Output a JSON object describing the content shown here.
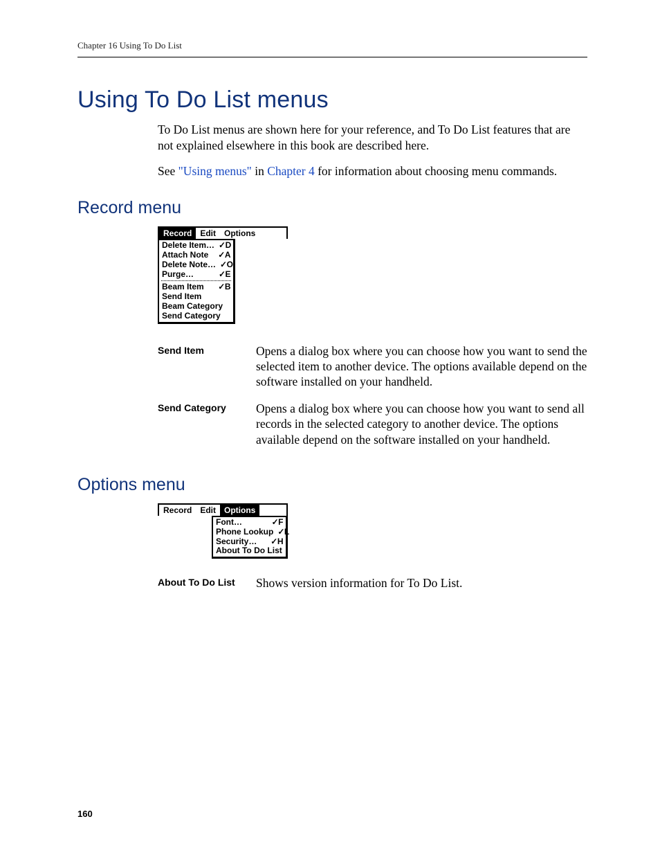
{
  "runningHead": "Chapter 16   Using To Do List",
  "title": "Using To Do List menus",
  "intro": {
    "p1": "To Do List menus are shown here for your reference, and To Do List features that are not explained elsewhere in this book are described here.",
    "p2a": "See ",
    "link1": "\"Using menus\"",
    "p2b": " in ",
    "link2": "Chapter 4",
    "p2c": " for information about choosing menu commands."
  },
  "sectionRecord": "Record menu",
  "recordMenu": {
    "bar": [
      "Record",
      "Edit",
      "Options"
    ],
    "selectedIndex": 0,
    "barTotalWidth": 188,
    "dropWidth": 112,
    "dropLeft": 0,
    "group1": [
      {
        "label": "Delete Item…",
        "sc": "D"
      },
      {
        "label": "Attach Note",
        "sc": "A"
      },
      {
        "label": "Delete Note…",
        "sc": "O"
      },
      {
        "label": "Purge…",
        "sc": "E"
      }
    ],
    "group2": [
      {
        "label": "Beam Item",
        "sc": "B"
      },
      {
        "label": "Send Item",
        "sc": ""
      },
      {
        "label": "Beam Category",
        "sc": ""
      },
      {
        "label": "Send Category",
        "sc": ""
      }
    ]
  },
  "recordDefs": [
    {
      "term": "Send Item",
      "body": "Opens a dialog box where you can choose how you want to send the selected item to another device. The options available depend on the software installed on your handheld."
    },
    {
      "term": "Send Category",
      "body": "Opens a dialog box where you can choose how you want to send all records in the selected category to another device. The options available depend on the software installed on your handheld."
    }
  ],
  "sectionOptions": "Options menu",
  "optionsMenu": {
    "bar": [
      "Record",
      "Edit",
      "Options"
    ],
    "selectedIndex": 2,
    "barTotalWidth": 188,
    "dropWidth": 110,
    "dropLeft": 78,
    "group1": [
      {
        "label": "Font…",
        "sc": "F"
      },
      {
        "label": "Phone Lookup",
        "sc": "L"
      },
      {
        "label": "Security…",
        "sc": "H"
      },
      {
        "label": "About To Do List",
        "sc": ""
      }
    ]
  },
  "optionsDefs": [
    {
      "term": "About To Do List",
      "body": "Shows version information for To Do List."
    }
  ],
  "pageNumber": "160"
}
